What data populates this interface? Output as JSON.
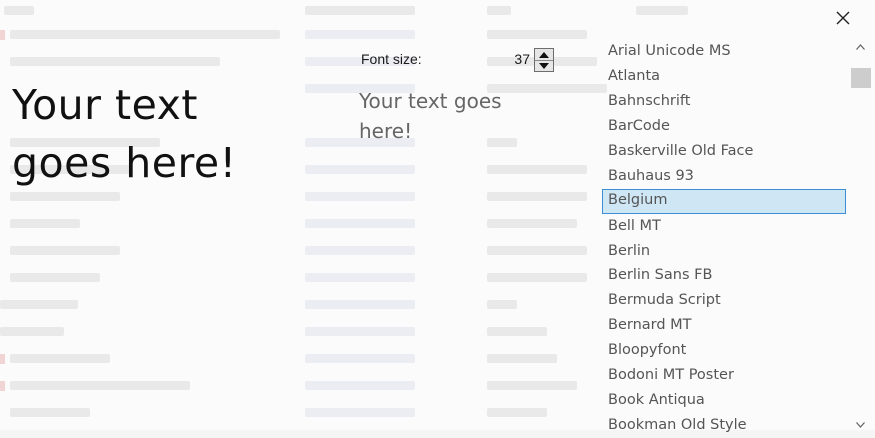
{
  "preview": {
    "big_text": "Your text goes here!",
    "small_text": "Your text goes here!"
  },
  "font_size": {
    "label": "Font size:",
    "value": "37"
  },
  "font_list": {
    "items": [
      "Arial Unicode MS",
      "Atlanta",
      "Bahnschrift",
      "BarCode",
      "Baskerville Old Face",
      "Bauhaus 93",
      "Belgium",
      "Bell MT",
      "Berlin",
      "Berlin Sans FB",
      "Bermuda Script",
      "Bernard MT",
      "Bloopyfont",
      "Bodoni MT Poster",
      "Book Antiqua",
      "Bookman Old Style"
    ],
    "selected": "Belgium"
  },
  "icons": {
    "close": "close-icon",
    "up": "caret-up-icon",
    "down": "caret-down-icon",
    "scroll_up": "chevron-up-icon",
    "scroll_down": "chevron-down-icon"
  },
  "colors": {
    "selection_fill": "#cfe6f5",
    "selection_border": "#3b8ed1",
    "scroll_thumb": "#cdcdcd"
  }
}
